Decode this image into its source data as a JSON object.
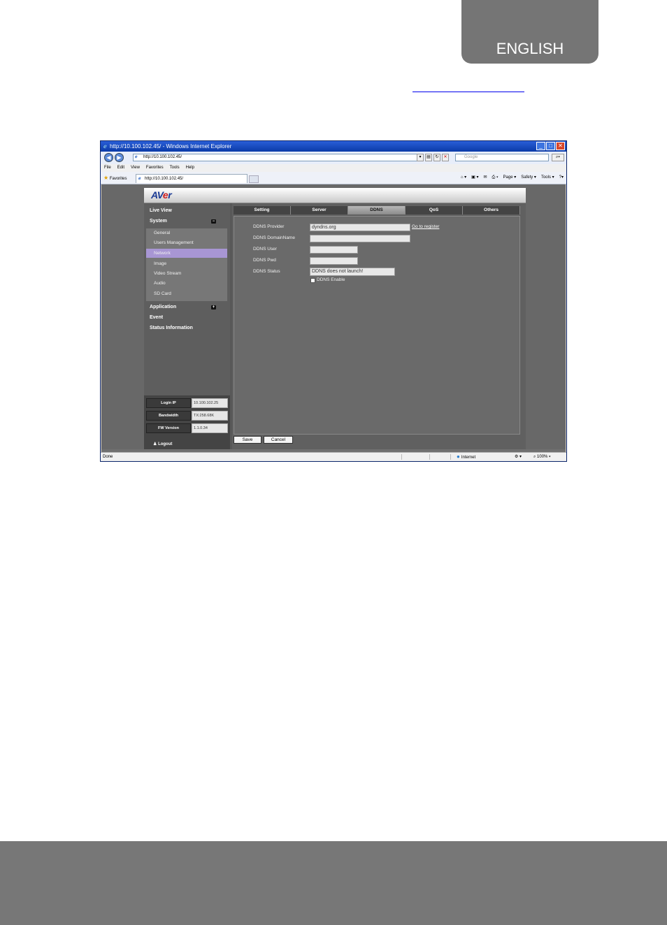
{
  "language_tab": "ENGLISH",
  "browser": {
    "title": "http://10.100.102.45/ - Windows Internet Explorer",
    "address": "http://10.100.102.45/",
    "search_placeholder": "Google",
    "menu": [
      "File",
      "Edit",
      "View",
      "Favorites",
      "Tools",
      "Help"
    ],
    "favorites_label": "Favorites",
    "tab_title": "http://10.100.102.45/",
    "commands": [
      "Page ▾",
      "Safety ▾",
      "Tools ▾"
    ],
    "status_text": "Done",
    "status_zone": "Internet",
    "zoom": "100%"
  },
  "app": {
    "logo": {
      "main": "AV",
      "accent": "e",
      "end": "r"
    },
    "nav": {
      "live_view": "Live View",
      "system": "System",
      "system_toggle": "−",
      "application": "Application",
      "application_toggle": "+",
      "event": "Event",
      "status_information": "Status Information"
    },
    "submenu": [
      "General",
      "Users Management",
      "Network",
      "Image",
      "Video Stream",
      "Audio",
      "SD Card"
    ],
    "info": {
      "login_ip_label": "Login IP",
      "login_ip_value": "10.100.102.25",
      "bandwidth_label": "Bandwidth",
      "bandwidth_value": "TX:258.68K",
      "fw_version_label": "FW Version",
      "fw_version_value": "1.1.0.34",
      "logout": "Logout"
    },
    "tabs": [
      "Setting",
      "Server",
      "DDNS",
      "QoS",
      "Others"
    ],
    "form": {
      "provider_label": "DDNS Provider",
      "provider_value": "dyndns.org",
      "register_link": "Go to register",
      "domain_label": "DDNS DomainName",
      "domain_value": "",
      "user_label": "DDNS User",
      "user_value": "",
      "pwd_label": "DDNS Pwd",
      "pwd_value": "",
      "status_label": "DDNS Status",
      "status_value": "DDNS does not launch!",
      "enable_label": "DDNS Enable"
    },
    "buttons": {
      "save": "Save",
      "cancel": "Cancel"
    }
  }
}
